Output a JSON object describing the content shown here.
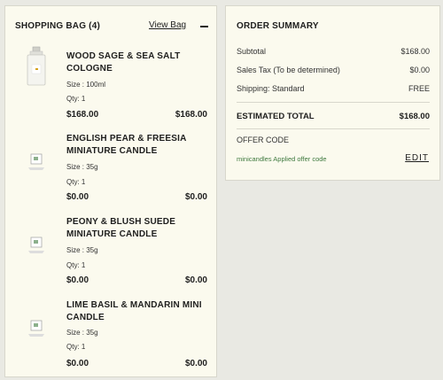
{
  "bag": {
    "title": "SHOPPING BAG (4)",
    "view_bag": "View Bag",
    "items": [
      {
        "name": "WOOD SAGE & SEA SALT COLOGNE",
        "size": "Size : 100ml",
        "qty": "Qty: 1",
        "price": "$168.00",
        "total": "$168.00",
        "thumb_icon": "cologne-bottle-icon"
      },
      {
        "name": "ENGLISH PEAR & FREESIA MINIATURE CANDLE",
        "size": "Size : 35g",
        "qty": "Qty: 1",
        "price": "$0.00",
        "total": "$0.00",
        "thumb_icon": "broken-image-icon"
      },
      {
        "name": "PEONY & BLUSH SUEDE MINIATURE CANDLE",
        "size": "Size : 35g",
        "qty": "Qty: 1",
        "price": "$0.00",
        "total": "$0.00",
        "thumb_icon": "broken-image-icon"
      },
      {
        "name": "LIME BASIL & MANDARIN MINI CANDLE",
        "size": "Size : 35g",
        "qty": "Qty: 1",
        "price": "$0.00",
        "total": "$0.00",
        "thumb_icon": "broken-image-icon"
      }
    ]
  },
  "summary": {
    "title": "ORDER SUMMARY",
    "subtotal_label": "Subtotal",
    "subtotal_value": "$168.00",
    "tax_label": "Sales Tax (To be determined)",
    "tax_value": "$0.00",
    "shipping_label": "Shipping:  Standard",
    "shipping_value": "FREE",
    "total_label": "ESTIMATED TOTAL",
    "total_value": "$168.00",
    "offer_label": "OFFER CODE",
    "offer_applied": "minicandles Applied offer code",
    "edit_label": "EDIT"
  },
  "colors": {
    "panel_bg": "#fbfaee",
    "page_bg": "#e9e9e3",
    "offer_green": "#3f7a3f"
  }
}
